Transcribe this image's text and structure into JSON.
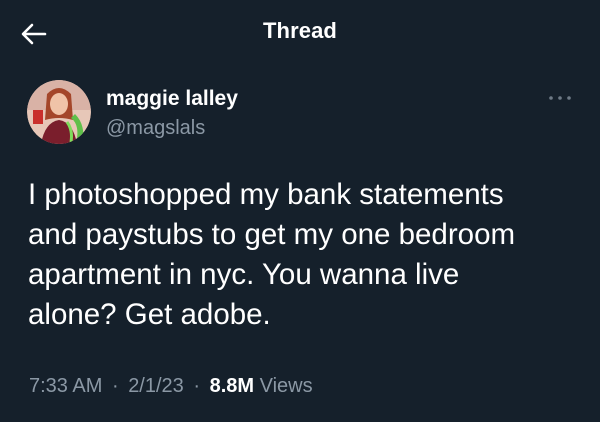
{
  "header": {
    "title": "Thread",
    "back_icon": "arrow-left-icon"
  },
  "tweet": {
    "author_name": "maggie lalley",
    "author_handle": "@magslals",
    "more_icon": "more-horizontal-icon",
    "text": "I photoshopped my bank statements\nand paystubs to get my one bedroom\napartment in nyc. You wanna live\nalone? Get adobe.",
    "time": "7:33 AM",
    "separator": "·",
    "date": "2/1/23",
    "views_count": "8.8M",
    "views_label": "Views"
  },
  "colors": {
    "background": "#15202b",
    "primary_text": "#ffffff",
    "secondary_text": "#8b98a5"
  }
}
